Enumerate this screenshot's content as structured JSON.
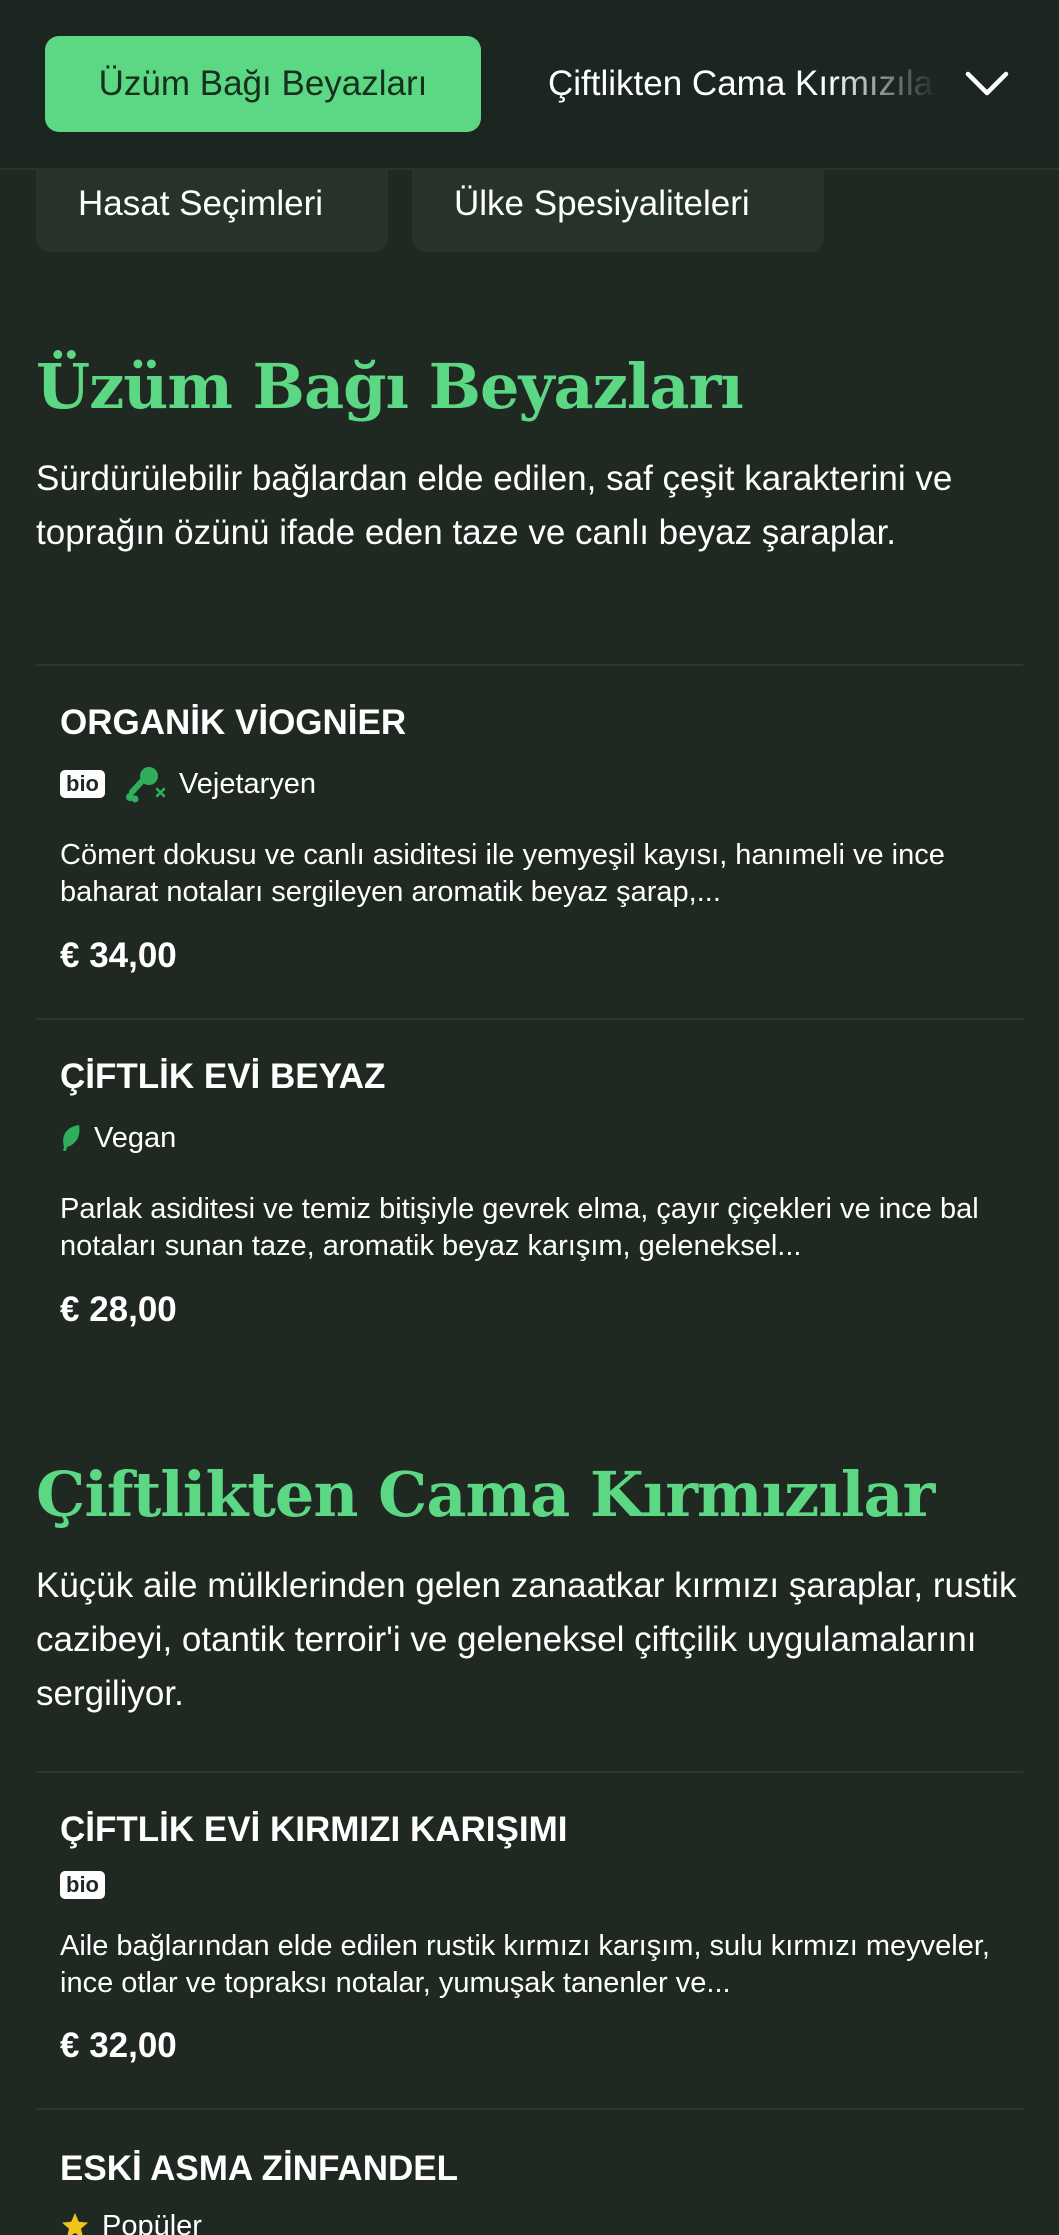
{
  "nav": {
    "active_tab": "Üzüm Bağı Beyazları",
    "next_tab": "Çiftlikten Cama Kırmızılar",
    "chips": [
      "Hasat Seçimleri",
      "Ülke Spesiyaliteleri"
    ]
  },
  "sections": [
    {
      "title": "Üzüm Bağı Beyazları",
      "description": "Sürdürülebilir bağlardan elde edilen, saf çeşit karakterini ve toprağın özünü ifade eden taze ve canlı beyaz şaraplar.",
      "items": [
        {
          "name": "ORGANİK VİOGNİER",
          "badge": "bio",
          "tag": "Vejetaryen",
          "description": "Cömert dokusu ve canlı asiditesi ile yemyeşil kayısı, hanımeli ve ince baharat notaları sergileyen aromatik beyaz şarap,...",
          "price": "€ 34,00"
        },
        {
          "name": "ÇİFTLİK EVİ BEYAZ",
          "tag": "Vegan",
          "description": "Parlak asiditesi ve temiz bitişiyle gevrek elma, çayır çiçekleri ve ince bal notaları sunan taze, aromatik beyaz karışım, geleneksel...",
          "price": "€ 28,00"
        }
      ]
    },
    {
      "title": "Çiftlikten Cama Kırmızılar",
      "description": "Küçük aile mülklerinden gelen zanaatkar kırmızı şaraplar, rustik cazibeyi, otantik terroir'i ve geleneksel çiftçilik uygulamalarını sergiliyor.",
      "items": [
        {
          "name": "ÇİFTLİK EVİ KIRMIZI KARIŞIMI",
          "badge": "bio",
          "description": "Aile bağlarından elde edilen rustik kırmızı karışım, sulu kırmızı meyveler, ince otlar ve topraksı notalar, yumuşak tanenler ve...",
          "price": "€ 32,00"
        },
        {
          "name": "ESKİ ASMA ZİNFANDEL",
          "tag": "Popüler"
        }
      ]
    }
  ],
  "colors": {
    "background": "#1f2922",
    "accent": "#5cd884",
    "chip": "#26322a",
    "star": "#f2c318"
  },
  "icons": {
    "vegetarian": "drumstick-crossed-icon",
    "vegan": "leaf-icon",
    "popular": "star-icon",
    "nav_more": "chevron-down-icon"
  }
}
